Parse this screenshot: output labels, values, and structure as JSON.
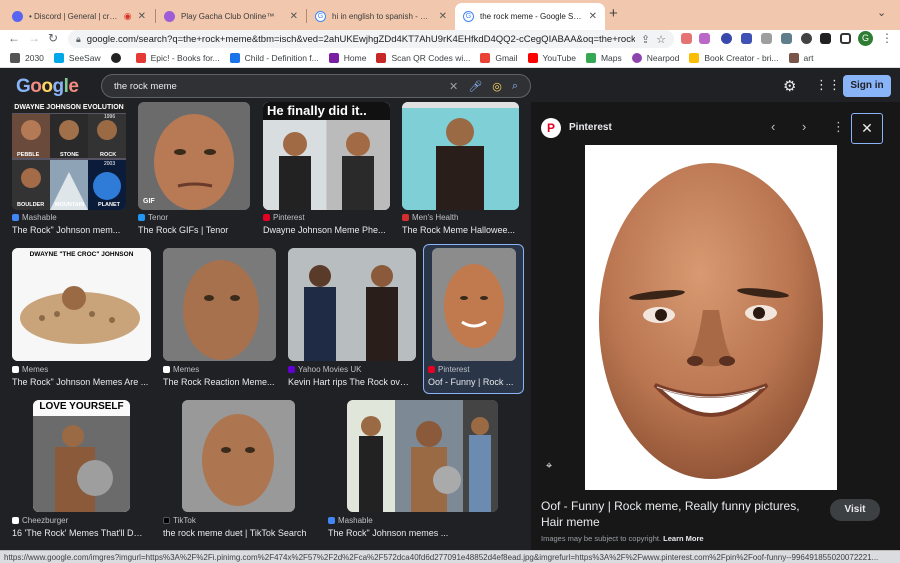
{
  "tabs": [
    {
      "title": "• Discord | General | creep",
      "color": "#5865f2"
    },
    {
      "title": "Play Gacha Club Online™",
      "color": "#a05bd6"
    },
    {
      "title": "hi in english to spanish - Goog",
      "color": "#4285f4"
    },
    {
      "title": "the rock meme - Google Search",
      "color": "#4285f4"
    }
  ],
  "toolbar": {
    "url": "google.com/search?q=the+rock+meme&tbm=isch&ved=2ahUKEwjhgZDd4KT7AhU9rK4EHfkdD4QQ2-cCegQIABAA&oq=the+rock+..."
  },
  "bookmarks": [
    {
      "label": "2030",
      "color": "#555"
    },
    {
      "label": "SeeSaw",
      "color": "#00a8e8"
    },
    {
      "label": "",
      "color": "#222"
    },
    {
      "label": "Epic! - Books for...",
      "color": "#e53935"
    },
    {
      "label": "Child - Definition f...",
      "color": "#1a73e8"
    },
    {
      "label": "Home",
      "color": "#7b1fa2"
    },
    {
      "label": "Scan QR Codes wi...",
      "color": "#c62828"
    },
    {
      "label": "Gmail",
      "color": "#ea4335"
    },
    {
      "label": "YouTube",
      "color": "#ff0000"
    },
    {
      "label": "Maps",
      "color": "#34a853"
    },
    {
      "label": "Nearpod",
      "color": "#8e44ad"
    },
    {
      "label": "Book Creator - bri...",
      "color": "#fbbc04"
    },
    {
      "label": "art",
      "color": "#795548"
    }
  ],
  "google": {
    "logo": "Google",
    "query": "the rock meme",
    "signin": "Sign in"
  },
  "results": [
    {
      "source": "Mashable",
      "title": "The Rock\" Johnson mem...",
      "src_color": "#4285f4",
      "headline": "DWAYNE JOHNSON EVOLUTION",
      "captions": [
        "1996",
        "PEBBLE",
        "STONE",
        "ROCK",
        "2003",
        "BOULDER",
        "MOUNTAIN",
        "PLANET"
      ]
    },
    {
      "source": "Tenor",
      "title": "The Rock GIFs | Tenor",
      "src_color": "#2196f3",
      "headline": "GIF"
    },
    {
      "source": "Pinterest",
      "title": "Dwayne Johnson Meme Phe...",
      "src_color": "#e60023",
      "headline": "He finally did it.."
    },
    {
      "source": "Men's Health",
      "title": "The Rock Meme Hallowee...",
      "src_color": "#d32f2f"
    },
    {
      "source": "Memes",
      "title": "The Rock\" Johnson Memes Are ...",
      "src_color": "#ffffff",
      "headline": "DWAYNE \"THE CROC\" JOHNSON"
    },
    {
      "source": "Memes",
      "title": "The Rock Reaction Meme...",
      "src_color": "#ffffff"
    },
    {
      "source": "Yahoo Movies UK",
      "title": "Kevin Hart rips The Rock ove...",
      "src_color": "#6001d2"
    },
    {
      "source": "Pinterest",
      "title": "Oof - Funny | Rock ...",
      "src_color": "#e60023"
    },
    {
      "source": "Cheezburger",
      "title": "16 'The Rock' Memes That'll Dw...",
      "src_color": "#ffffff",
      "headline": "LOVE YOURSELF"
    },
    {
      "source": "TikTok",
      "title": "the rock meme duet | TikTok Search",
      "src_color": "#000000"
    },
    {
      "source": "Mashable",
      "title": "The Rock\" Johnson memes ...",
      "src_color": "#4285f4"
    }
  ],
  "panel": {
    "source": "Pinterest",
    "title": "Oof - Funny | Rock meme, Really funny pictures, Hair meme",
    "visit": "Visit",
    "note": "Images may be subject to copyright.",
    "learn_more": "Learn More"
  },
  "status": "https://www.google.com/imgres?imgurl=https%3A%2F%2Fi.pinimg.com%2F474x%2F57%2F2d%2Fca%2F572dca40fd6d277091e48852d4ef8ead.jpg&imgrefurl=https%3A%2F%2Fwww.pinterest.com%2Fpin%2Foof-funny--996491855020072221..."
}
